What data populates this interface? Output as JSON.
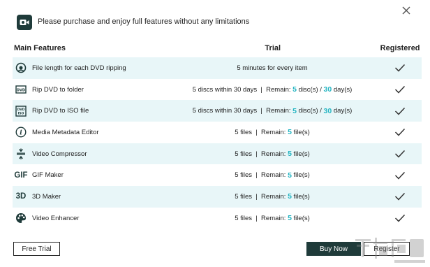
{
  "header": {
    "message": "Please purchase and enjoy full features without any limitations"
  },
  "icons": {
    "logo": "app-logo-icon",
    "close": "close-icon",
    "check": "checkmark-icon"
  },
  "table": {
    "headers": {
      "feature": "Main Features",
      "trial": "Trial",
      "registered": "Registered"
    },
    "rows": [
      {
        "icon": "clock-icon",
        "feature": "File length for each DVD ripping",
        "trial_plain": "5 minutes for every item"
      },
      {
        "icon": "dvd-folder-icon",
        "feature": "Rip DVD to folder",
        "trial_pre": "5 discs within 30 days  |  Remain: ",
        "remain_count": "5",
        "trial_mid": " disc(s) / ",
        "days_count": "30",
        "trial_post": " day(s)"
      },
      {
        "icon": "dvd-iso-icon",
        "feature": "Rip DVD to ISO file",
        "trial_pre": "5 discs within 30 days  |  Remain: ",
        "remain_count": "5",
        "trial_mid": " disc(s) / ",
        "days_count": "30",
        "trial_post": " day(s)"
      },
      {
        "icon": "info-icon",
        "feature": "Media Metadata Editor",
        "trial_pre": "5 files  |  Remain: ",
        "remain_count": "5",
        "trial_post": " file(s)"
      },
      {
        "icon": "compress-icon",
        "feature": "Video Compressor",
        "trial_pre": "5 files  |  Remain: ",
        "remain_count": "5",
        "trial_post": " file(s)"
      },
      {
        "icon": "gif-icon",
        "icon_text": "GIF",
        "feature": "GIF Maker",
        "trial_pre": "5 files  |  Remain: ",
        "remain_count": "5",
        "trial_post": " file(s)"
      },
      {
        "icon": "3d-icon",
        "icon_text": "3D",
        "feature": "3D Maker",
        "trial_pre": "5 files  |  Remain: ",
        "remain_count": "5",
        "trial_post": " file(s)"
      },
      {
        "icon": "palette-icon",
        "feature": "Video Enhancer",
        "trial_pre": "5 files  |  Remain: ",
        "remain_count": "5",
        "trial_post": " file(s)"
      }
    ]
  },
  "buttons": {
    "free_trial": "Free Trial",
    "buy_now": "Buy Now",
    "register": "Register"
  },
  "colors": {
    "accent": "#25b5c2",
    "row_highlight": "#e8f6f8",
    "dark_button": "#1f3b3a"
  }
}
